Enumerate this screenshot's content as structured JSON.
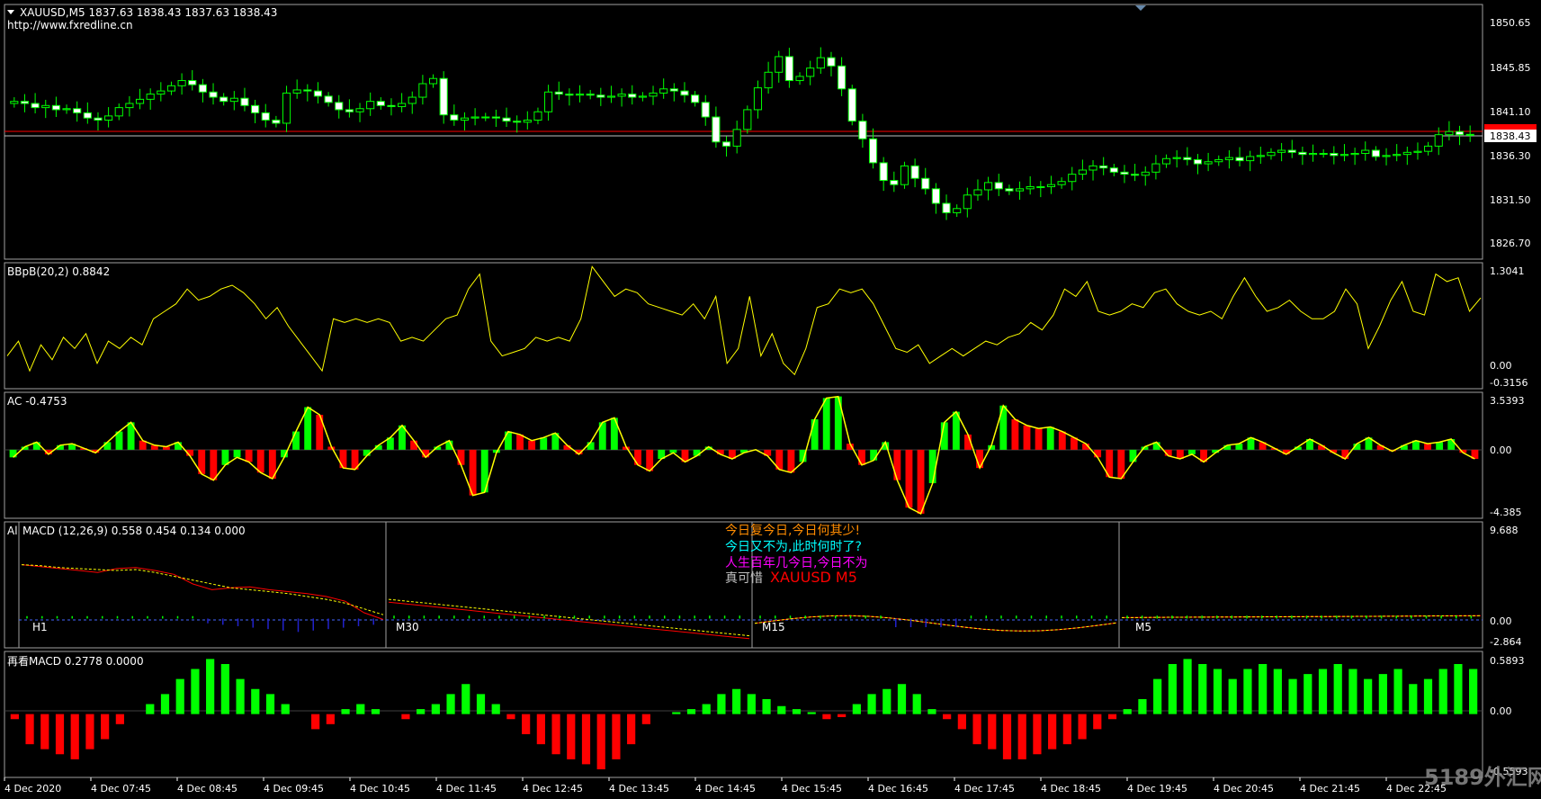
{
  "header": {
    "symbol_line": "XAUUSD,M5  1837.63 1838.43 1837.63 1838.43",
    "website": "http://www.fxredline.cn"
  },
  "main_axis": {
    "ticks": [
      "1850.65",
      "1845.85",
      "1841.10",
      "1836.30",
      "1831.50",
      "1826.70"
    ],
    "current_price": "1838.43"
  },
  "bbpb": {
    "title": "BBpB(20,2) 0.8842",
    "ticks": [
      "1.3041",
      "0.00",
      "-0.3156"
    ]
  },
  "ac": {
    "title": "AC -0.4753",
    "ticks": [
      "3.5393",
      "0.00",
      "-4.385"
    ]
  },
  "macd": {
    "title": "MACD (12,26,9) 0.558 0.454 0.134 0.000",
    "left_prefix": "Al",
    "ticks": [
      "9.688",
      "0.00",
      "-2.864"
    ],
    "panes": [
      "H1",
      "M30",
      "M15",
      "M5"
    ],
    "poem": [
      "今日复今日,今日何其少!",
      "今日又不为,此时何时了?",
      "人生百年几今日,今日不为",
      "真可惜"
    ],
    "overlay": "XAUUSD  M5"
  },
  "macd2": {
    "title": "再看MACD 0.2778 0.0000",
    "ticks": [
      "0.5893",
      "0.00",
      "-0.5593"
    ]
  },
  "time_axis": [
    "4 Dec 2020",
    "4 Dec 07:45",
    "4 Dec 08:45",
    "4 Dec 09:45",
    "4 Dec 10:45",
    "4 Dec 11:45",
    "4 Dec 12:45",
    "4 Dec 13:45",
    "4 Dec 14:45",
    "4 Dec 15:45",
    "4 Dec 16:45",
    "4 Dec 17:45",
    "4 Dec 18:45",
    "4 Dec 19:45",
    "4 Dec 20:45",
    "4 Dec 21:45",
    "4 Dec 22:45"
  ],
  "watermark": "5189外汇网",
  "colors": {
    "bull": "#00ff00",
    "bear": "#ff0000",
    "bbpb_line": "#ffff00",
    "macd_signal": "#ffff00",
    "macd_main": "#ff0000",
    "poem1": "#ff8c00",
    "poem2": "#00ffff",
    "poem3": "#ff00ff",
    "poem4": "#c0c0c0"
  },
  "chart_data": [
    {
      "type": "candlestick",
      "title": "XAUUSD,M5",
      "ylim": [
        1826.7,
        1850.65
      ],
      "open": 1837.63,
      "high": 1838.43,
      "low": 1837.63,
      "close": 1838.43,
      "close_series": [
        1841.6,
        1841.4,
        1841.0,
        1841.2,
        1840.8,
        1840.9,
        1840.5,
        1840.0,
        1839.8,
        1840.2,
        1841.0,
        1841.4,
        1841.8,
        1842.3,
        1842.6,
        1843.1,
        1843.6,
        1843.2,
        1842.5,
        1842.0,
        1841.6,
        1841.9,
        1841.2,
        1840.5,
        1839.8,
        1839.5,
        1842.4,
        1842.7,
        1842.6,
        1842.1,
        1841.5,
        1840.8,
        1840.6,
        1840.9,
        1841.6,
        1841.2,
        1841.1,
        1841.4,
        1842.0,
        1843.3,
        1843.8,
        1840.3,
        1839.8,
        1840.0,
        1840.1,
        1840.1,
        1840.0,
        1839.7,
        1839.6,
        1839.8,
        1840.6,
        1842.5,
        1842.3,
        1842.2,
        1842.3,
        1842.2,
        1842.0,
        1842.1,
        1842.3,
        1842.0,
        1842.1,
        1842.4,
        1842.8,
        1842.6,
        1842.2,
        1841.5,
        1840.1,
        1837.7,
        1837.3,
        1838.9,
        1840.8,
        1842.9,
        1844.4,
        1845.9,
        1843.6,
        1844.0,
        1844.8,
        1845.8,
        1845.0,
        1842.8,
        1839.7,
        1838.0,
        1835.7,
        1834.0,
        1833.6,
        1835.4,
        1834.2,
        1833.2,
        1831.8,
        1830.9,
        1831.3,
        1832.6,
        1833.1,
        1833.8,
        1833.2,
        1833.0,
        1833.2,
        1833.4,
        1833.4,
        1833.6,
        1833.9,
        1834.6,
        1835.0,
        1835.4,
        1835.2,
        1834.8,
        1834.6,
        1834.5,
        1834.8,
        1835.6,
        1836.1,
        1836.2,
        1836.0,
        1835.6,
        1835.8,
        1836.0,
        1836.2,
        1835.9,
        1836.3,
        1836.4,
        1836.7,
        1836.9,
        1836.7,
        1836.5,
        1836.6,
        1836.6,
        1836.4,
        1836.5,
        1836.6,
        1836.9,
        1836.3,
        1836.4,
        1836.5,
        1836.7,
        1836.8,
        1837.3,
        1838.4,
        1838.7,
        1838.4,
        1838.43
      ]
    },
    {
      "type": "line",
      "title": "BBpB(20,2)",
      "ylim": [
        -0.3156,
        1.3041
      ],
      "values": [
        0.1,
        0.3,
        -0.1,
        0.25,
        0.05,
        0.35,
        0.2,
        0.4,
        0.0,
        0.3,
        0.2,
        0.35,
        0.25,
        0.6,
        0.7,
        0.8,
        1.0,
        0.85,
        0.9,
        1.0,
        1.05,
        0.95,
        0.8,
        0.6,
        0.75,
        0.5,
        0.3,
        0.1,
        -0.1,
        0.6,
        0.55,
        0.6,
        0.55,
        0.6,
        0.55,
        0.3,
        0.35,
        0.3,
        0.45,
        0.6,
        0.65,
        1.0,
        1.2,
        0.3,
        0.1,
        0.15,
        0.2,
        0.35,
        0.3,
        0.35,
        0.3,
        0.6,
        1.3,
        1.1,
        0.9,
        1.0,
        0.95,
        0.8,
        0.75,
        0.7,
        0.65,
        0.8,
        0.6,
        0.9,
        0.0,
        0.2,
        0.9,
        0.1,
        0.4,
        0.0,
        -0.15,
        0.2,
        0.75,
        0.8,
        1.0,
        0.95,
        1.0,
        0.8,
        0.5,
        0.2,
        0.15,
        0.25,
        0.0,
        0.1,
        0.2,
        0.1,
        0.2,
        0.3,
        0.25,
        0.35,
        0.4,
        0.55,
        0.45,
        0.65,
        1.0,
        0.9,
        1.1,
        0.7,
        0.65,
        0.7,
        0.8,
        0.75,
        0.95,
        1.0,
        0.8,
        0.7,
        0.65,
        0.7,
        0.6,
        0.9,
        1.15,
        0.9,
        0.7,
        0.75,
        0.85,
        0.7,
        0.6,
        0.6,
        0.7,
        1.0,
        0.8,
        0.2,
        0.5,
        0.85,
        1.1,
        0.7,
        0.65,
        1.2,
        1.1,
        1.15,
        0.7,
        0.88
      ]
    },
    {
      "type": "bar",
      "title": "AC",
      "ylim": [
        -4.385,
        3.5393
      ],
      "values": [
        -0.5,
        0.2,
        0.5,
        -0.3,
        0.3,
        0.4,
        0.1,
        -0.2,
        0.5,
        1.2,
        1.8,
        0.6,
        0.3,
        0.2,
        0.5,
        -0.4,
        -1.6,
        -2.0,
        -1.0,
        -0.5,
        -0.8,
        -1.5,
        -1.9,
        -0.5,
        1.2,
        2.8,
        2.3,
        0.2,
        -1.2,
        -1.3,
        -0.4,
        0.3,
        0.8,
        1.6,
        0.6,
        -0.5,
        0.2,
        0.6,
        -1.0,
        -3.0,
        -2.8,
        -0.2,
        1.2,
        1.0,
        0.6,
        0.8,
        1.1,
        0.3,
        -0.3,
        0.5,
        1.8,
        2.1,
        0.2,
        -1.0,
        -1.4,
        -0.6,
        -0.2,
        -0.8,
        -0.4,
        0.2,
        -0.3,
        -0.6,
        -0.2,
        0.0,
        -0.4,
        -1.3,
        -1.5,
        -0.8,
        2.0,
        3.4,
        3.5,
        0.4,
        -1.0,
        -0.7,
        0.5,
        -2.0,
        -3.8,
        -4.2,
        -2.2,
        1.8,
        2.5,
        1.0,
        -1.2,
        0.3,
        2.9,
        2.0,
        1.6,
        1.4,
        1.5,
        1.2,
        0.8,
        0.4,
        -0.5,
        -1.8,
        -1.9,
        -0.8,
        0.2,
        0.5,
        -0.4,
        -0.6,
        -0.3,
        -0.8,
        -0.2,
        0.3,
        0.4,
        0.8,
        0.5,
        0.1,
        -0.3,
        0.2,
        0.7,
        0.3,
        -0.2,
        -0.6,
        0.4,
        0.8,
        0.3,
        -0.1,
        0.3,
        0.6,
        0.4,
        0.5,
        0.7,
        -0.2,
        -0.6
      ]
    },
    {
      "type": "line",
      "title": "MACD (12,26,9)",
      "ylim": [
        -2.864,
        9.688
      ],
      "series": [
        {
          "name": "main",
          "values": [
            5.6,
            5.4,
            5.2,
            5.0,
            4.8,
            5.2,
            5.3,
            5.0,
            4.6,
            3.6,
            3.0,
            3.2,
            3.3,
            3.0,
            2.8,
            2.6,
            2.3,
            1.8,
            0.6,
            -0.1
          ]
        },
        {
          "name": "signal",
          "values": [
            5.6,
            5.5,
            5.3,
            5.2,
            5.1,
            5.0,
            5.1,
            4.8,
            4.4,
            4.0,
            3.6,
            3.2,
            3.0,
            2.8,
            2.6,
            2.3,
            2.0,
            1.6,
            1.0,
            0.4
          ]
        }
      ]
    },
    {
      "type": "bar",
      "title": "再看MACD",
      "ylim": [
        -0.5593,
        0.5893
      ],
      "values": [
        -0.05,
        -0.3,
        -0.35,
        -0.4,
        -0.45,
        -0.35,
        -0.25,
        -0.1,
        0.0,
        0.1,
        0.2,
        0.35,
        0.45,
        0.55,
        0.5,
        0.35,
        0.25,
        0.2,
        0.1,
        0.0,
        -0.15,
        -0.1,
        0.05,
        0.1,
        0.05,
        0.0,
        -0.05,
        0.05,
        0.1,
        0.2,
        0.3,
        0.2,
        0.1,
        -0.05,
        -0.2,
        -0.3,
        -0.4,
        -0.45,
        -0.5,
        -0.55,
        -0.45,
        -0.3,
        -0.1,
        0.0,
        0.02,
        0.05,
        0.1,
        0.2,
        0.25,
        0.2,
        0.15,
        0.08,
        0.05,
        0.02,
        -0.05,
        -0.03,
        0.1,
        0.2,
        0.25,
        0.3,
        0.2,
        0.05,
        -0.05,
        -0.15,
        -0.3,
        -0.35,
        -0.45,
        -0.45,
        -0.4,
        -0.35,
        -0.3,
        -0.25,
        -0.15,
        -0.05,
        0.05,
        0.15,
        0.35,
        0.5,
        0.55,
        0.5,
        0.45,
        0.35,
        0.45,
        0.5,
        0.45,
        0.35,
        0.4,
        0.45,
        0.5,
        0.45,
        0.35,
        0.4,
        0.45,
        0.3,
        0.35,
        0.45,
        0.5,
        0.45
      ]
    }
  ]
}
